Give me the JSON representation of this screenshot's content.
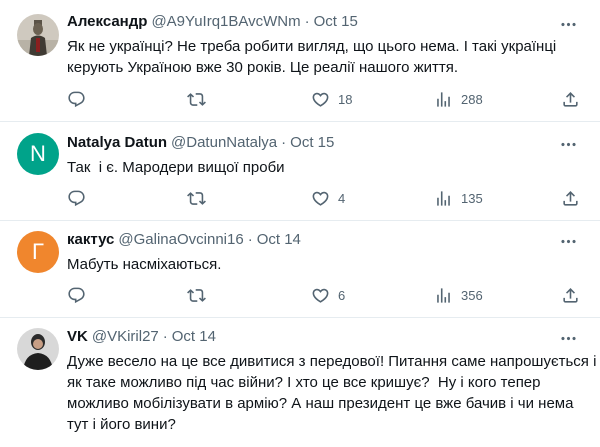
{
  "tweets": [
    {
      "name": "Александр",
      "handle": "@A9YuIrq1BAvcWNm",
      "separator": "·",
      "date": "Oct 15",
      "lines": [
        "Як не українці? Не треба робити вигляд, що цього нема. І такі українці",
        "керують Україною вже 30 років. Це реалії нашого життя."
      ],
      "replies": "",
      "retweets": "",
      "likes": "18",
      "views": "288"
    },
    {
      "name": "Natalya Datun",
      "handle": "@DatunNatalya",
      "separator": "·",
      "date": "Oct 15",
      "avatar_letter": "N",
      "avatar_color": "#00a38a",
      "lines": [
        "Так  і є. Мародери вищої проби"
      ],
      "replies": "",
      "retweets": "",
      "likes": "4",
      "views": "135"
    },
    {
      "name": "кактус",
      "handle": "@GalinaOvcinni16",
      "separator": "·",
      "date": "Oct 14",
      "avatar_letter": "Г",
      "avatar_color": "#f0862d",
      "lines": [
        "Мабуть насміхаються."
      ],
      "replies": "",
      "retweets": "",
      "likes": "6",
      "views": "356"
    },
    {
      "name": "VK",
      "handle": "@VKiril27",
      "separator": "·",
      "date": "Oct 14",
      "lines": [
        "Дуже весело на це все дивитися з передової! Питання саме напрошується і",
        "як таке можливо під час війни? І хто це все кришує?  Ну і кого тепер",
        "можливо мобілізувати в армію? А наш президент це вже бачив і чи нема",
        "тут і його вини?"
      ]
    }
  ],
  "colors": {
    "text": "#0f1419",
    "secondary": "#536471",
    "divider": "#e6ecf0"
  },
  "icons": [
    "more-icon",
    "reply-icon",
    "retweet-icon",
    "like-icon",
    "views-icon",
    "share-icon"
  ]
}
